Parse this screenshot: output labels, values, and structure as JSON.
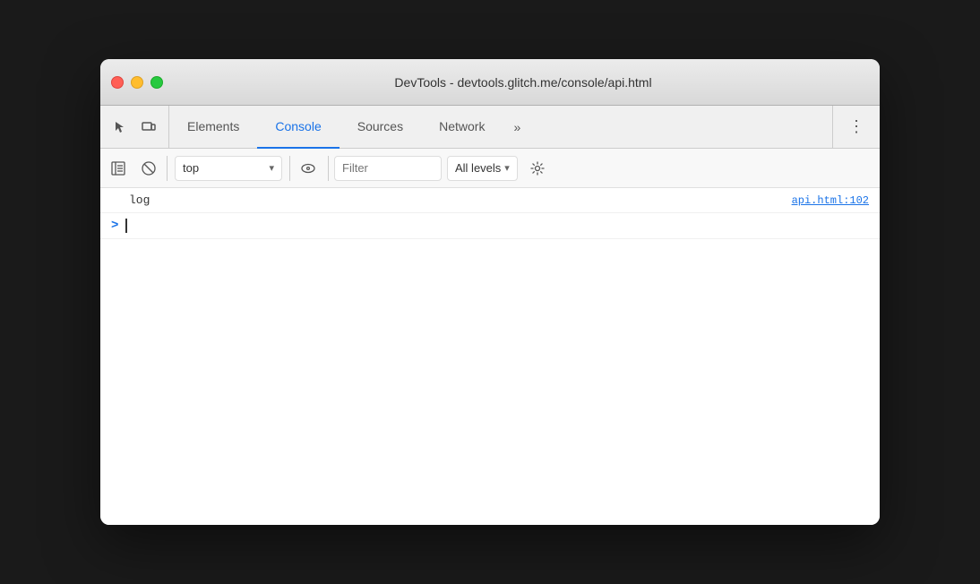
{
  "window": {
    "title": "DevTools - devtools.glitch.me/console/api.html",
    "traffic_lights": {
      "close_label": "close",
      "minimize_label": "minimize",
      "maximize_label": "maximize"
    }
  },
  "tab_bar": {
    "icons": [
      {
        "name": "cursor-icon",
        "symbol": "↖",
        "label": "Select element"
      },
      {
        "name": "device-icon",
        "symbol": "▭",
        "label": "Toggle device toolbar"
      }
    ],
    "tabs": [
      {
        "id": "elements",
        "label": "Elements",
        "active": false
      },
      {
        "id": "console",
        "label": "Console",
        "active": true
      },
      {
        "id": "sources",
        "label": "Sources",
        "active": false
      },
      {
        "id": "network",
        "label": "Network",
        "active": false
      }
    ],
    "more_label": "»",
    "menu_icon": "⋮"
  },
  "console_toolbar": {
    "sidebar_btn_label": "Show console sidebar",
    "clear_btn_label": "Clear console",
    "context_label": "top",
    "context_placeholder": "top",
    "dropdown_arrow": "▾",
    "eye_label": "Live expressions",
    "filter_placeholder": "Filter",
    "levels_label": "All levels",
    "levels_arrow": "▾",
    "settings_label": "Console settings"
  },
  "console_log": [
    {
      "text": "log",
      "source": "api.html:102"
    }
  ],
  "console_input": {
    "prompt": ">",
    "value": ""
  }
}
